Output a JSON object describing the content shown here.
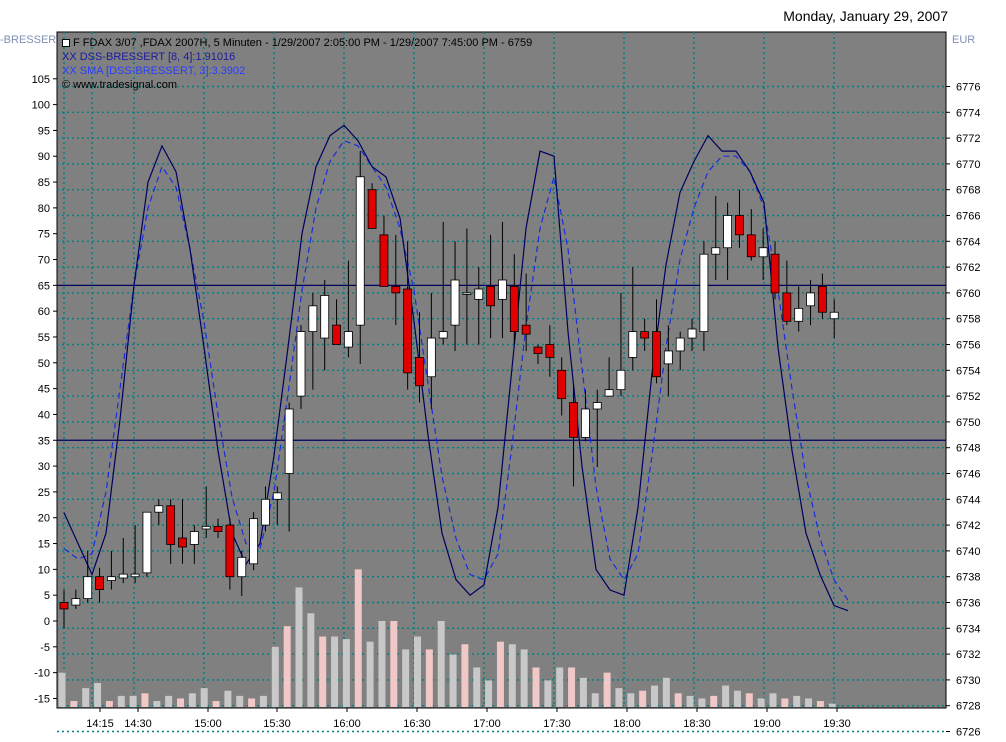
{
  "header": {
    "date": "Monday, January 29, 2007",
    "left_indicator_label": "-BRESSERT",
    "right_unit": "EUR"
  },
  "legend": {
    "instrument": "F FDAX 3/07 ,FDAX 2007H, 5 Minuten - 1/29/2007 2:05:00 PM - 1/29/2007 7:45:00 PM - 6759",
    "dss": "XX DSS-BRESSERT [8, 4]:1.91016",
    "sma": "XX SMA [DSS-BRESSERT, 3]:3.3902",
    "copyright": "© www.tradesignal.com"
  },
  "colors": {
    "plot_bg": "#808080",
    "grid": "#008080",
    "up_candle": "#ffffff",
    "down_candle": "#e00000",
    "dss_line": "#000060",
    "sma_line": "#1a2cdc",
    "hline": "#000060",
    "volume_up": "#c8c8c8",
    "volume_down": "#f0c8c8"
  },
  "chart_data": {
    "type": "candlestick",
    "xlabels": [
      "14:15",
      "14:30",
      "15:00",
      "15:30",
      "16:00",
      "16:30",
      "17:00",
      "17:30",
      "18:00",
      "18:30",
      "19:00",
      "19:30"
    ],
    "left_axis": {
      "ticks": [
        105,
        100,
        95,
        90,
        85,
        80,
        75,
        70,
        65,
        60,
        55,
        50,
        45,
        40,
        35,
        30,
        25,
        20,
        15,
        10,
        5,
        0,
        -5,
        -10,
        -15
      ],
      "range": [
        -17,
        108
      ]
    },
    "right_axis": {
      "ticks": [
        6776,
        6774,
        6772,
        6770,
        6768,
        6766,
        6764,
        6762,
        6760,
        6758,
        6756,
        6754,
        6752,
        6750,
        6748,
        6746,
        6744,
        6742,
        6740,
        6738,
        6736,
        6734,
        6732,
        6730,
        6728,
        6726
      ],
      "range": [
        6725,
        6776
      ]
    },
    "hlines_dss": [
      65,
      35
    ],
    "candles": [
      {
        "o": 6736.0,
        "h": 6737.0,
        "l": 6734.0,
        "c": 6735.5
      },
      {
        "o": 6735.8,
        "h": 6737.0,
        "l": 6735.5,
        "c": 6736.3
      },
      {
        "o": 6736.3,
        "h": 6740.0,
        "l": 6736.0,
        "c": 6738.0
      },
      {
        "o": 6738.0,
        "h": 6738.7,
        "l": 6736.0,
        "c": 6737.0
      },
      {
        "o": 6737.7,
        "h": 6740.0,
        "l": 6737.0,
        "c": 6738.0
      },
      {
        "o": 6737.9,
        "h": 6741.0,
        "l": 6737.5,
        "c": 6738.2
      },
      {
        "o": 6738.0,
        "h": 6742.0,
        "l": 6737.5,
        "c": 6738.2
      },
      {
        "o": 6738.3,
        "h": 6743.0,
        "l": 6738.0,
        "c": 6743.0
      },
      {
        "o": 6743.0,
        "h": 6744.0,
        "l": 6742.0,
        "c": 6743.5
      },
      {
        "o": 6743.5,
        "h": 6744.0,
        "l": 6739.0,
        "c": 6740.5
      },
      {
        "o": 6741.0,
        "h": 6744.0,
        "l": 6739.0,
        "c": 6740.3
      },
      {
        "o": 6740.5,
        "h": 6742.0,
        "l": 6739.0,
        "c": 6741.5
      },
      {
        "o": 6741.7,
        "h": 6745.0,
        "l": 6741.0,
        "c": 6741.9
      },
      {
        "o": 6741.9,
        "h": 6742.5,
        "l": 6741.0,
        "c": 6741.5
      },
      {
        "o": 6742.0,
        "h": 6742.5,
        "l": 6737.0,
        "c": 6738.0
      },
      {
        "o": 6738.0,
        "h": 6740.0,
        "l": 6736.5,
        "c": 6739.5
      },
      {
        "o": 6739.0,
        "h": 6743.0,
        "l": 6738.5,
        "c": 6742.5
      },
      {
        "o": 6742.0,
        "h": 6745.0,
        "l": 6741.5,
        "c": 6744.0
      },
      {
        "o": 6744.0,
        "h": 6745.0,
        "l": 6742.0,
        "c": 6744.5
      },
      {
        "o": 6746.0,
        "h": 6751.5,
        "l": 6741.5,
        "c": 6751.0
      },
      {
        "o": 6752.0,
        "h": 6757.5,
        "l": 6751.0,
        "c": 6757.0
      },
      {
        "o": 6757.0,
        "h": 6760.0,
        "l": 6752.5,
        "c": 6759.0
      },
      {
        "o": 6756.5,
        "h": 6761.0,
        "l": 6754.0,
        "c": 6759.8
      },
      {
        "o": 6757.5,
        "h": 6759.5,
        "l": 6756.0,
        "c": 6756.0
      },
      {
        "o": 6755.8,
        "h": 6762.5,
        "l": 6755.0,
        "c": 6757.0
      },
      {
        "o": 6757.5,
        "h": 6771.0,
        "l": 6754.5,
        "c": 6769.0
      },
      {
        "o": 6768.0,
        "h": 6768.5,
        "l": 6765.0,
        "c": 6765.0
      },
      {
        "o": 6764.5,
        "h": 6766.0,
        "l": 6760.5,
        "c": 6760.5
      },
      {
        "o": 6760.5,
        "h": 6764.5,
        "l": 6757.5,
        "c": 6760.0
      },
      {
        "o": 6760.3,
        "h": 6764.0,
        "l": 6752.5,
        "c": 6753.8
      },
      {
        "o": 6755.0,
        "h": 6758.5,
        "l": 6751.5,
        "c": 6752.8
      },
      {
        "o": 6753.5,
        "h": 6760.0,
        "l": 6751.0,
        "c": 6756.5
      },
      {
        "o": 6756.5,
        "h": 6765.5,
        "l": 6756.0,
        "c": 6757.0
      },
      {
        "o": 6757.5,
        "h": 6764.0,
        "l": 6755.5,
        "c": 6761.0
      },
      {
        "o": 6760.0,
        "h": 6765.0,
        "l": 6756.0,
        "c": 6760.0
      },
      {
        "o": 6759.5,
        "h": 6762.0,
        "l": 6756.0,
        "c": 6760.3
      },
      {
        "o": 6760.5,
        "h": 6764.5,
        "l": 6756.5,
        "c": 6759.0
      },
      {
        "o": 6759.5,
        "h": 6765.5,
        "l": 6756.5,
        "c": 6761.0
      },
      {
        "o": 6760.5,
        "h": 6763.0,
        "l": 6756.0,
        "c": 6757.0
      },
      {
        "o": 6757.5,
        "h": 6761.5,
        "l": 6755.5,
        "c": 6756.8
      },
      {
        "o": 6755.8,
        "h": 6756.0,
        "l": 6754.5,
        "c": 6755.3
      },
      {
        "o": 6756.0,
        "h": 6757.5,
        "l": 6753.5,
        "c": 6755.0
      },
      {
        "o": 6754.0,
        "h": 6755.0,
        "l": 6750.5,
        "c": 6751.8
      },
      {
        "o": 6751.5,
        "h": 6753.0,
        "l": 6745.0,
        "c": 6748.8
      },
      {
        "o": 6748.8,
        "h": 6752.5,
        "l": 6748.5,
        "c": 6751.0
      },
      {
        "o": 6751.0,
        "h": 6752.5,
        "l": 6746.5,
        "c": 6751.5
      },
      {
        "o": 6752.0,
        "h": 6755.0,
        "l": 6752.0,
        "c": 6752.5
      },
      {
        "o": 6752.5,
        "h": 6760.0,
        "l": 6752.0,
        "c": 6754.0
      },
      {
        "o": 6755.0,
        "h": 6762.0,
        "l": 6754.0,
        "c": 6757.0
      },
      {
        "o": 6757.0,
        "h": 6758.0,
        "l": 6755.5,
        "c": 6756.5
      },
      {
        "o": 6757.0,
        "h": 6759.5,
        "l": 6753.0,
        "c": 6753.5
      },
      {
        "o": 6754.5,
        "h": 6757.5,
        "l": 6752.0,
        "c": 6755.5
      },
      {
        "o": 6755.5,
        "h": 6757.0,
        "l": 6754.0,
        "c": 6756.5
      },
      {
        "o": 6756.5,
        "h": 6758.0,
        "l": 6755.5,
        "c": 6757.2
      },
      {
        "o": 6757.0,
        "h": 6764.0,
        "l": 6755.5,
        "c": 6763.0
      },
      {
        "o": 6763.0,
        "h": 6767.5,
        "l": 6761.0,
        "c": 6763.5
      },
      {
        "o": 6763.5,
        "h": 6767.0,
        "l": 6761.0,
        "c": 6766.0
      },
      {
        "o": 6766.0,
        "h": 6768.0,
        "l": 6763.5,
        "c": 6764.5
      },
      {
        "o": 6764.5,
        "h": 6766.5,
        "l": 6762.5,
        "c": 6762.8
      },
      {
        "o": 6762.8,
        "h": 6765.0,
        "l": 6761.0,
        "c": 6763.5
      },
      {
        "o": 6763.0,
        "h": 6764.0,
        "l": 6759.5,
        "c": 6760.0
      },
      {
        "o": 6760.0,
        "h": 6762.5,
        "l": 6757.5,
        "c": 6757.8
      },
      {
        "o": 6757.8,
        "h": 6760.5,
        "l": 6757.0,
        "c": 6758.8
      },
      {
        "o": 6759.0,
        "h": 6761.0,
        "l": 6757.5,
        "c": 6760.0
      },
      {
        "o": 6760.5,
        "h": 6761.5,
        "l": 6758.0,
        "c": 6758.5
      },
      {
        "o": 6758.0,
        "h": 6759.5,
        "l": 6756.5,
        "c": 6758.5
      }
    ],
    "volume_dss": [
      -10,
      -15.5,
      -13,
      -12,
      -15.5,
      -14.5,
      -14.5,
      -14,
      -15.5,
      -14.5,
      -15,
      -14,
      -13,
      -15.5,
      -13.5,
      -14.5,
      -15,
      -14.5,
      -5,
      -1,
      6.5,
      1.5,
      -3,
      -3,
      -3.5,
      10,
      -4,
      0,
      0,
      -5.5,
      -3,
      -5.5,
      0,
      -6.5,
      -4.5,
      -9,
      -11.5,
      -4,
      -4.5,
      -5.5,
      -9,
      -11.5,
      -9,
      -9,
      -11,
      -14,
      -10,
      -13,
      -14,
      -13.5,
      -12.5,
      -11,
      -14,
      -14.5,
      -15,
      -14.5,
      -12.5,
      -13.5,
      -14,
      -15,
      -14,
      -15,
      -14.5,
      -15,
      -15.5,
      -16
    ],
    "dss": [
      21,
      15,
      9,
      17,
      39,
      65,
      85,
      92,
      87,
      72,
      53,
      33,
      17,
      11,
      15,
      32,
      53,
      75,
      88,
      94,
      96,
      93,
      88,
      86,
      78,
      58,
      36,
      17,
      8,
      5,
      7,
      22,
      49,
      76,
      91,
      90,
      56,
      30,
      10,
      6,
      5,
      22,
      48,
      69,
      83,
      89,
      94,
      91,
      91,
      87,
      81,
      53,
      33,
      17,
      9,
      3,
      2
    ],
    "sma": [
      14,
      12,
      13,
      25,
      45,
      65,
      80,
      88,
      84,
      72,
      58,
      40,
      24,
      15,
      14,
      25,
      44,
      64,
      80,
      89,
      93,
      92,
      88,
      84,
      76,
      64,
      46,
      28,
      16,
      9,
      8,
      13,
      34,
      57,
      76,
      86,
      72,
      49,
      26,
      12,
      8,
      13,
      32,
      53,
      70,
      80,
      87,
      90,
      90,
      87,
      80,
      64,
      45,
      28,
      16,
      8,
      4
    ],
    "dss_x_start": 64,
    "dss_x_step": 14.0
  }
}
